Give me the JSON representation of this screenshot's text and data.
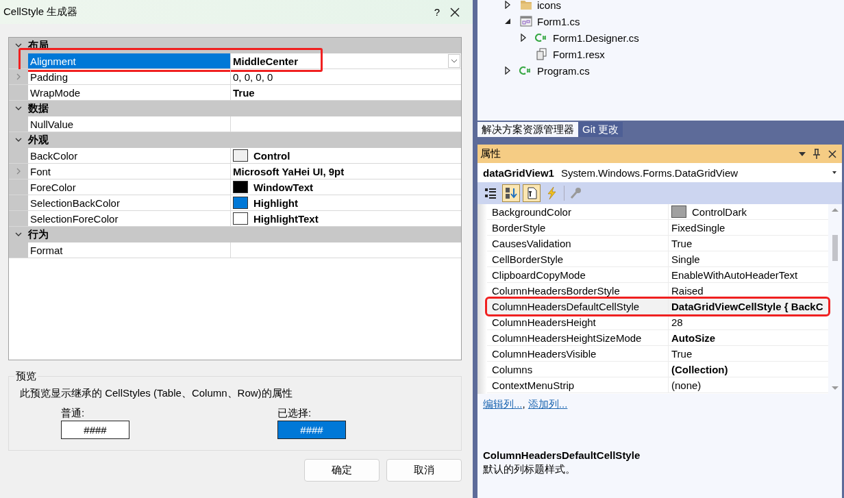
{
  "dialog": {
    "title": "CellStyle 生成器",
    "help_button": "?",
    "property_grid": {
      "categories": [
        {
          "name": "布局",
          "expanded": true,
          "properties": [
            {
              "name": "Alignment",
              "value": "MiddleCenter",
              "bold": true,
              "selected": true,
              "annotated": true,
              "expandable": false
            },
            {
              "name": "Padding",
              "value": "0, 0, 0, 0",
              "bold": false,
              "selected": false,
              "annotated": false,
              "expandable": true
            },
            {
              "name": "WrapMode",
              "value": "True",
              "bold": true,
              "selected": false,
              "annotated": false,
              "expandable": false
            }
          ]
        },
        {
          "name": "数据",
          "expanded": true,
          "properties": [
            {
              "name": "NullValue",
              "selected": false,
              "annotated": false,
              "expandable": false
            }
          ]
        },
        {
          "name": "外观",
          "expanded": true,
          "properties": [
            {
              "name": "BackColor",
              "value": "Control",
              "bold": true,
              "color": "#f0f0f0",
              "selected": false,
              "annotated": false,
              "expandable": false
            },
            {
              "name": "Font",
              "value": "Microsoft YaHei UI, 9pt",
              "bold": true,
              "selected": false,
              "annotated": false,
              "expandable": true
            },
            {
              "name": "ForeColor",
              "value": "WindowText",
              "bold": true,
              "color": "#000000",
              "selected": false,
              "annotated": false,
              "expandable": false
            },
            {
              "name": "SelectionBackColor",
              "value": "Highlight",
              "bold": true,
              "color": "#0078d7",
              "selected": false,
              "annotated": false,
              "expandable": false
            },
            {
              "name": "SelectionForeColor",
              "value": "HighlightText",
              "bold": true,
              "color": "#ffffff",
              "selected": false,
              "annotated": false,
              "expandable": false
            }
          ]
        },
        {
          "name": "行为",
          "expanded": true,
          "properties": [
            {
              "name": "Format",
              "selected": false,
              "annotated": false,
              "expandable": false
            }
          ]
        }
      ]
    },
    "preview": {
      "title": "预览",
      "description": "此预览显示继承的 CellStyles (Table、Column、Row)的属性",
      "samples": [
        {
          "label": "普通:",
          "text": "####",
          "selected": false
        },
        {
          "label": "已选择:",
          "text": "####",
          "selected": true
        }
      ]
    },
    "buttons": [
      "确定",
      "取消"
    ]
  },
  "solution_explorer": {
    "tree": [
      {
        "name": "icons",
        "kind": "folder",
        "expanded": false
      },
      {
        "name": "Form1.cs",
        "kind": "form",
        "expanded": true,
        "children": [
          {
            "name": "Form1.Designer.cs",
            "kind": "csharp",
            "expanded": false,
            "expandable": true
          },
          {
            "name": "Form1.resx",
            "kind": "resource",
            "expandable": false
          }
        ]
      },
      {
        "name": "Program.cs",
        "kind": "csharp",
        "expanded": false
      }
    ],
    "tabs": [
      {
        "label": "解决方案资源管理器",
        "selected": true
      },
      {
        "label": "Git 更改",
        "selected": false
      }
    ]
  },
  "properties_panel": {
    "title": "属性",
    "object_name": "dataGridView1",
    "object_type": "System.Windows.Forms.DataGridView",
    "toolbar": [
      {
        "kind": "categorized",
        "selected": false
      },
      {
        "kind": "alphabetical",
        "selected": true
      },
      {
        "kind": "properties",
        "selected": true
      },
      {
        "kind": "events",
        "selected": false
      },
      {
        "kind": "pages",
        "selected": false
      }
    ],
    "rows": [
      {
        "name": "BackgroundColor",
        "value": "ControlDark",
        "bold": false,
        "color": "#a0a0a0",
        "annotated": false
      },
      {
        "name": "BorderStyle",
        "value": "FixedSingle",
        "bold": false,
        "annotated": false
      },
      {
        "name": "CausesValidation",
        "value": "True",
        "bold": false,
        "annotated": false
      },
      {
        "name": "CellBorderStyle",
        "value": "Single",
        "bold": false,
        "annotated": false
      },
      {
        "name": "ClipboardCopyMode",
        "value": "EnableWithAutoHeaderText",
        "bold": false,
        "annotated": false
      },
      {
        "name": "ColumnHeadersBorderStyle",
        "value": "Raised",
        "bold": false,
        "annotated": false
      },
      {
        "name": "ColumnHeadersDefaultCellStyle",
        "value": "DataGridViewCellStyle { BackC",
        "bold": true,
        "annotated": true
      },
      {
        "name": "ColumnHeadersHeight",
        "value": "28",
        "bold": false,
        "annotated": false
      },
      {
        "name": "ColumnHeadersHeightSizeMode",
        "value": "AutoSize",
        "bold": true,
        "annotated": false
      },
      {
        "name": "ColumnHeadersVisible",
        "value": "True",
        "bold": false,
        "annotated": false
      },
      {
        "name": "Columns",
        "value": "(Collection)",
        "bold": true,
        "annotated": false
      },
      {
        "name": "ContextMenuStrip",
        "value": "(none)",
        "bold": false,
        "annotated": false
      }
    ],
    "links": [
      "编辑列...",
      "添加列..."
    ],
    "link_separator": ",",
    "description": {
      "title": "ColumnHeadersDefaultCellStyle",
      "text": "默认的列标题样式。"
    }
  }
}
